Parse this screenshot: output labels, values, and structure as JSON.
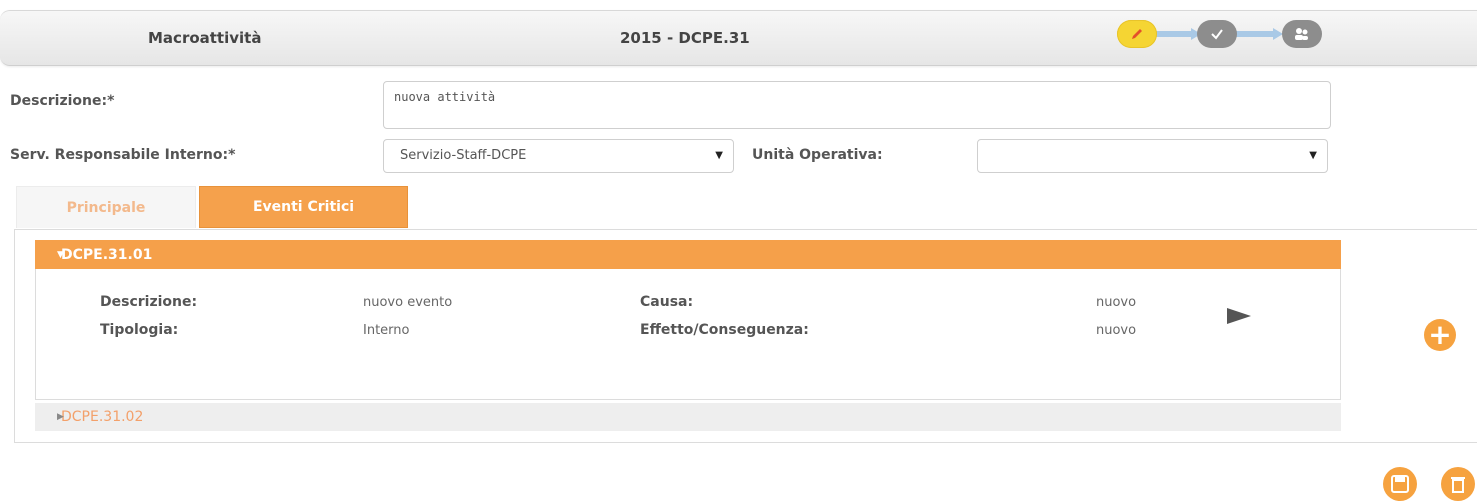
{
  "header": {
    "title": "Macroattività",
    "code": "2015 - DCPE.31",
    "workflow_icons": [
      "pencil-icon",
      "check-icon",
      "users-icon"
    ],
    "workflow_colors": {
      "active": "#f5d533",
      "inactive": "#8d8d8d",
      "connector": "#a9c9e6"
    }
  },
  "form": {
    "descrizione_label": "Descrizione:*",
    "descrizione_value": "nuova attività",
    "serv_label": "Serv. Responsabile Interno:*",
    "serv_value": "Servizio-Staff-DCPE",
    "unita_label": "Unità Operativa:",
    "unita_value": ""
  },
  "tabs": [
    {
      "label": "Principale",
      "active": false
    },
    {
      "label": "Eventi Critici",
      "active": true
    }
  ],
  "events": [
    {
      "code": "DCPE.31.01",
      "expanded": true,
      "fields": {
        "descrizione_label": "Descrizione:",
        "descrizione_value": "nuovo evento",
        "tipologia_label": "Tipologia:",
        "tipologia_value": "Interno",
        "causa_label": "Causa:",
        "causa_value": "nuovo",
        "effetto_label": "Effetto/Conseguenza:",
        "effetto_value": "nuovo"
      }
    },
    {
      "code": "DCPE.31.02",
      "expanded": false
    }
  ],
  "accent_color": "#f5a04a",
  "actions": [
    "add-icon",
    "save-icon",
    "delete-icon"
  ]
}
